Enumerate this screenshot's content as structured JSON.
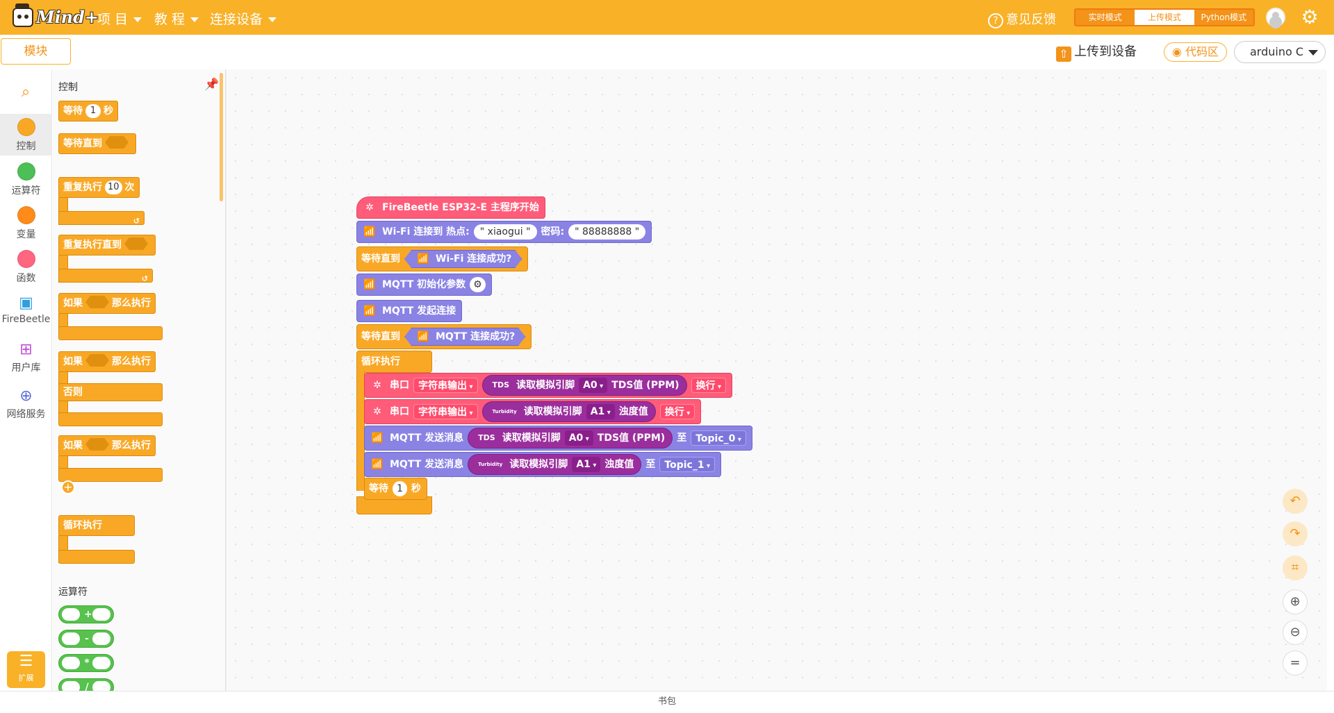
{
  "app": {
    "logo_text": "Mind+"
  },
  "menu": [
    {
      "label": "项 目"
    },
    {
      "label": "教 程"
    },
    {
      "label": "连接设备"
    }
  ],
  "header": {
    "feedback": "意见反馈",
    "modes": [
      "实时模式",
      "上传模式",
      "Python模式"
    ],
    "active_mode": "上传模式",
    "tab_blocks": "模块",
    "upload": "上传到设备",
    "code_area": "代码区",
    "board": "arduino C"
  },
  "categories": [
    {
      "label": "控制",
      "color": "#f9a826"
    },
    {
      "label": "运算符",
      "color": "#4cbf56"
    },
    {
      "label": "变量",
      "color": "#ff8c1a"
    },
    {
      "label": "函数",
      "color": "#ff6680"
    },
    {
      "label": "FireBeetle",
      "icon": "chip-icon"
    },
    {
      "label": "用户库",
      "icon": "blocks-plus-icon"
    },
    {
      "label": "网络服务",
      "icon": "globe-icon"
    }
  ],
  "extension": "扩展",
  "flyout": {
    "section_control": "控制",
    "wait": "等待",
    "wait_num": "1",
    "wait_unit": "秒",
    "wait_until": "等待直到",
    "repeat": "重复执行",
    "repeat_num": "10",
    "repeat_unit": "次",
    "repeat_until": "重复执行直到",
    "if": "如果",
    "then": "那么执行",
    "else": "否则",
    "forever": "循环执行",
    "section_operators": "运算符",
    "ops": [
      "+",
      "-",
      "*",
      "/"
    ]
  },
  "program": {
    "hat": "FireBeetle ESP32-E 主程序开始",
    "wifi_connect": "Wi-Fi 连接到 热点:",
    "ssid": "\" xiaogui \"",
    "password_label": "密码:",
    "password": "\" 88888888 \"",
    "wait_until": "等待直到",
    "wifi_ok": "Wi-Fi 连接成功?",
    "mqtt_init": "MQTT 初始化参数",
    "mqtt_connect": "MQTT 发起连接",
    "mqtt_ok": "MQTT 连接成功?",
    "forever": "循环执行",
    "serial": "串口",
    "string_out": "字符串输出",
    "tds_badge": "TDS",
    "turb_badge": "Turbidity",
    "read_pin": "读取模拟引脚",
    "pin_a0": "A0",
    "pin_a1": "A1",
    "tds_value": "TDS值 (PPM)",
    "turb_value": "浊度值",
    "newline": "换行",
    "mqtt_send": "MQTT 发送消息",
    "to": "至",
    "topic0": "Topic_0",
    "topic1": "Topic_1",
    "wait": "等待",
    "wait_num": "1",
    "wait_unit": "秒",
    "wifi_small": "WiFi",
    "mqtt_small": "MQTT"
  },
  "bottom": {
    "backpack": "书包"
  }
}
